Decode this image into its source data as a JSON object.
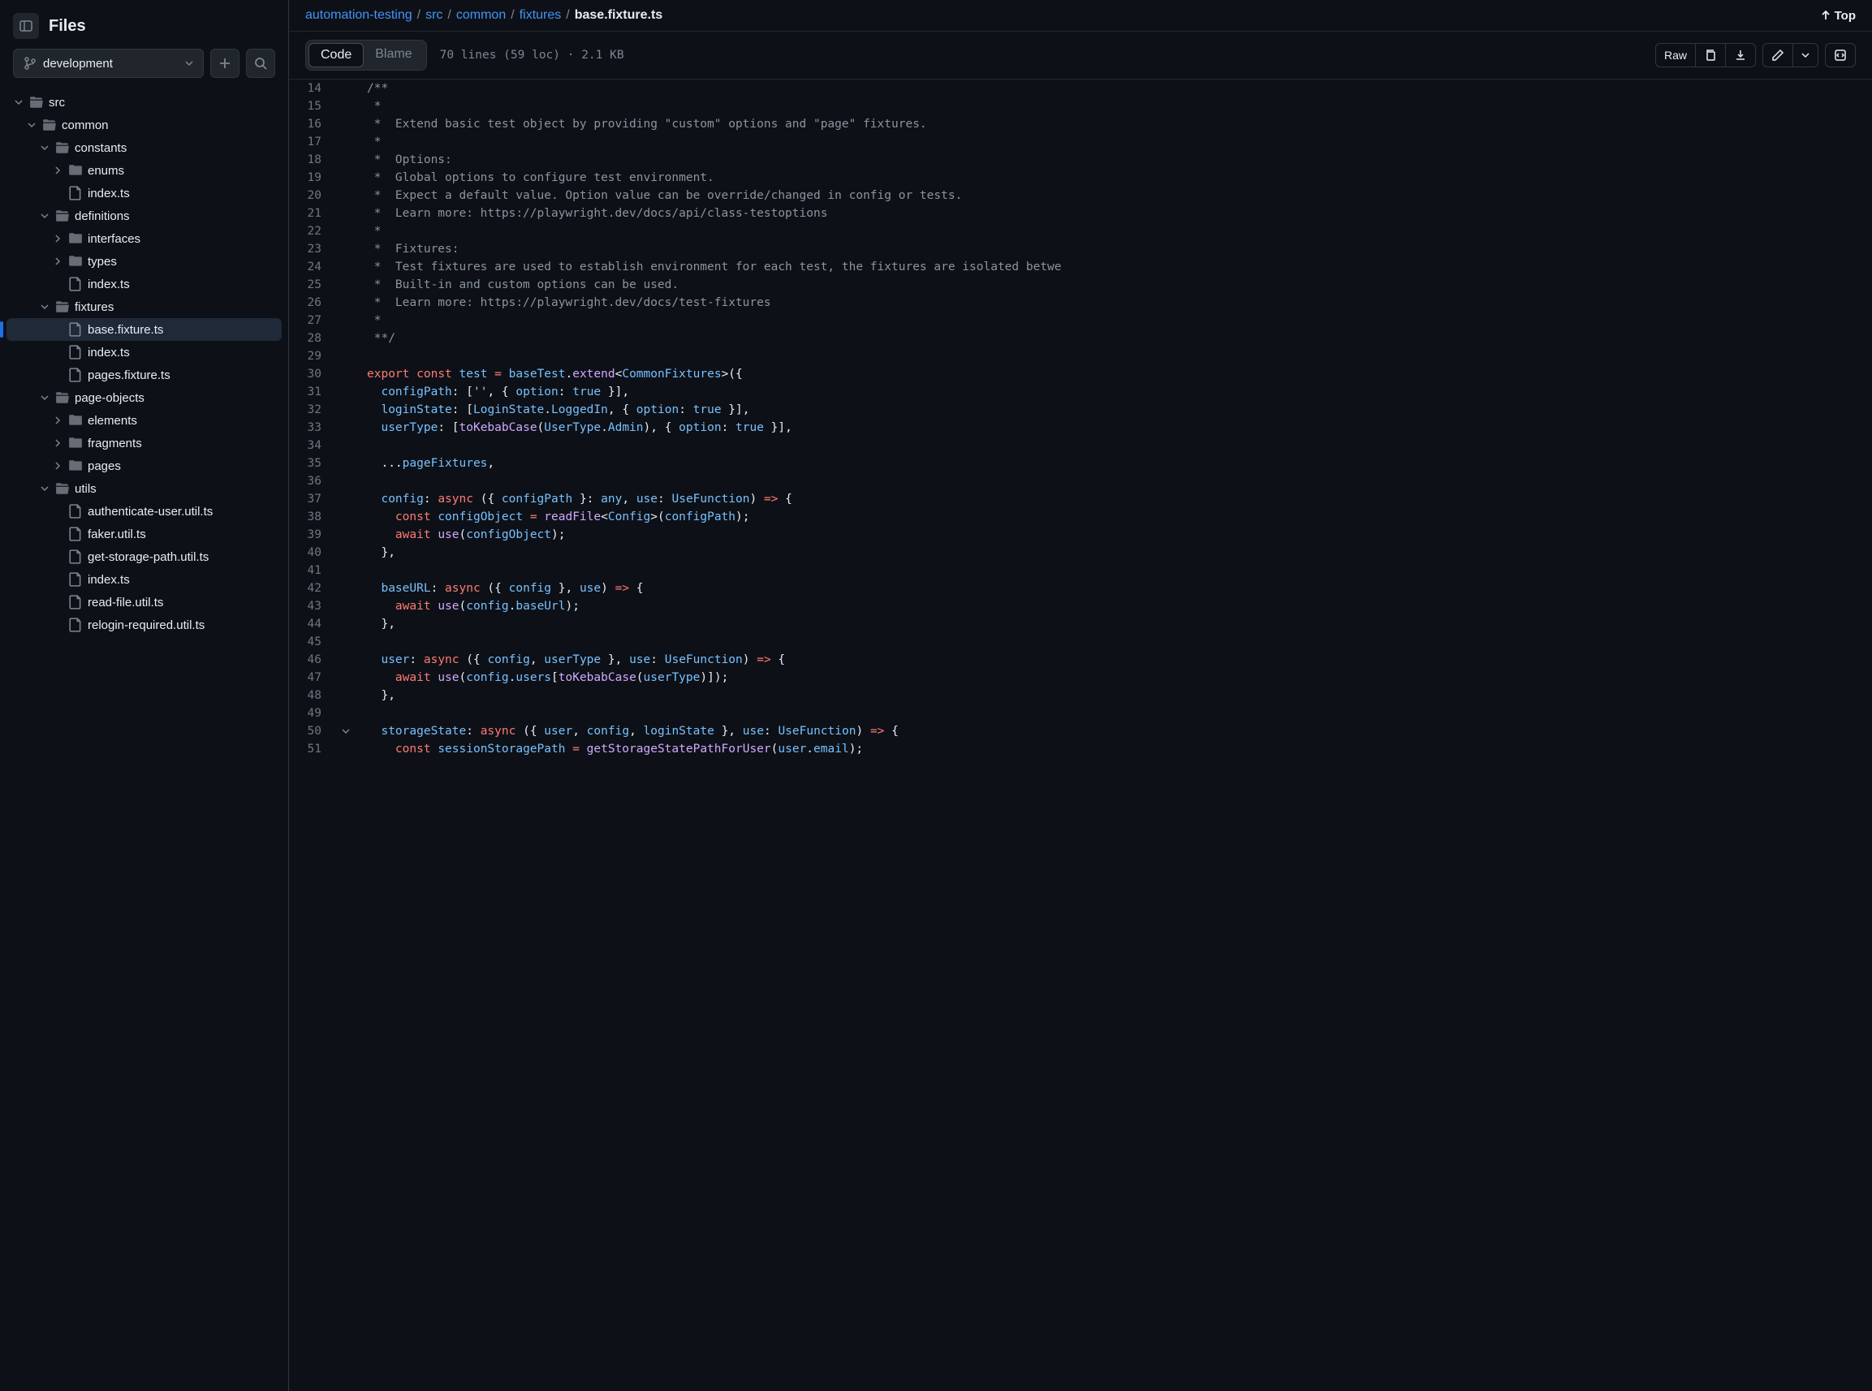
{
  "sidebar": {
    "title": "Files",
    "branch": "development"
  },
  "tree": [
    {
      "depth": 0,
      "type": "folder",
      "expanded": true,
      "label": "src"
    },
    {
      "depth": 1,
      "type": "folder",
      "expanded": true,
      "label": "common"
    },
    {
      "depth": 2,
      "type": "folder",
      "expanded": true,
      "label": "constants"
    },
    {
      "depth": 3,
      "type": "folder",
      "expanded": false,
      "label": "enums"
    },
    {
      "depth": 3,
      "type": "file",
      "label": "index.ts"
    },
    {
      "depth": 2,
      "type": "folder",
      "expanded": true,
      "label": "definitions"
    },
    {
      "depth": 3,
      "type": "folder",
      "expanded": false,
      "label": "interfaces"
    },
    {
      "depth": 3,
      "type": "folder",
      "expanded": false,
      "label": "types"
    },
    {
      "depth": 3,
      "type": "file",
      "label": "index.ts"
    },
    {
      "depth": 2,
      "type": "folder",
      "expanded": true,
      "label": "fixtures"
    },
    {
      "depth": 3,
      "type": "file",
      "label": "base.fixture.ts",
      "active": true
    },
    {
      "depth": 3,
      "type": "file",
      "label": "index.ts"
    },
    {
      "depth": 3,
      "type": "file",
      "label": "pages.fixture.ts"
    },
    {
      "depth": 2,
      "type": "folder",
      "expanded": true,
      "label": "page-objects"
    },
    {
      "depth": 3,
      "type": "folder",
      "expanded": false,
      "label": "elements"
    },
    {
      "depth": 3,
      "type": "folder",
      "expanded": false,
      "label": "fragments"
    },
    {
      "depth": 3,
      "type": "folder",
      "expanded": false,
      "label": "pages"
    },
    {
      "depth": 2,
      "type": "folder",
      "expanded": true,
      "label": "utils"
    },
    {
      "depth": 3,
      "type": "file",
      "label": "authenticate-user.util.ts"
    },
    {
      "depth": 3,
      "type": "file",
      "label": "faker.util.ts"
    },
    {
      "depth": 3,
      "type": "file",
      "label": "get-storage-path.util.ts"
    },
    {
      "depth": 3,
      "type": "file",
      "label": "index.ts"
    },
    {
      "depth": 3,
      "type": "file",
      "label": "read-file.util.ts"
    },
    {
      "depth": 3,
      "type": "file",
      "label": "relogin-required.util.ts"
    }
  ],
  "breadcrumb": {
    "parts": [
      "automation-testing",
      "src",
      "common",
      "fixtures"
    ],
    "current": "base.fixture.ts"
  },
  "topLabel": "Top",
  "tabs": {
    "code": "Code",
    "blame": "Blame"
  },
  "meta": "70 lines (59 loc) · 2.1 KB",
  "rawLabel": "Raw",
  "code": [
    {
      "n": 14,
      "html": "<span class='c-comment'>/**</span>"
    },
    {
      "n": 15,
      "html": "<span class='c-comment'> *</span>"
    },
    {
      "n": 16,
      "html": "<span class='c-comment'> *  Extend basic test object by providing \"custom\" options and \"page\" fixtures.</span>"
    },
    {
      "n": 17,
      "html": "<span class='c-comment'> *</span>"
    },
    {
      "n": 18,
      "html": "<span class='c-comment'> *  Options:</span>"
    },
    {
      "n": 19,
      "html": "<span class='c-comment'> *  Global options to configure test environment.</span>"
    },
    {
      "n": 20,
      "html": "<span class='c-comment'> *  Expect a default value. Option value can be override/changed in config or tests.</span>"
    },
    {
      "n": 21,
      "html": "<span class='c-comment'> *  Learn more: https://playwright.dev/docs/api/class-testoptions</span>"
    },
    {
      "n": 22,
      "html": "<span class='c-comment'> *</span>"
    },
    {
      "n": 23,
      "html": "<span class='c-comment'> *  Fixtures:</span>"
    },
    {
      "n": 24,
      "html": "<span class='c-comment'> *  Test fixtures are used to establish environment for each test, the fixtures are isolated betwe</span>"
    },
    {
      "n": 25,
      "html": "<span class='c-comment'> *  Built-in and custom options can be used.</span>"
    },
    {
      "n": 26,
      "html": "<span class='c-comment'> *  Learn more: https://playwright.dev/docs/test-fixtures</span>"
    },
    {
      "n": 27,
      "html": "<span class='c-comment'> *</span>"
    },
    {
      "n": 28,
      "html": "<span class='c-comment'> **/</span>"
    },
    {
      "n": 29,
      "html": ""
    },
    {
      "n": 30,
      "html": "<span class='c-keyword'>export</span> <span class='c-keyword'>const</span> <span class='c-ident'>test</span> <span class='c-keyword'>=</span> <span class='c-ident'>baseTest</span>.<span class='c-func'>extend</span>&lt;<span class='c-ident'>CommonFixtures</span>&gt;({"
    },
    {
      "n": 31,
      "html": "  <span class='c-ident'>configPath</span>: [<span class='c-string'>''</span>, { <span class='c-ident'>option</span>: <span class='c-ident'>true</span> }],"
    },
    {
      "n": 32,
      "html": "  <span class='c-ident'>loginState</span>: [<span class='c-ident'>LoginState</span>.<span class='c-ident'>LoggedIn</span>, { <span class='c-ident'>option</span>: <span class='c-ident'>true</span> }],"
    },
    {
      "n": 33,
      "html": "  <span class='c-ident'>userType</span>: [<span class='c-func'>toKebabCase</span>(<span class='c-ident'>UserType</span>.<span class='c-ident'>Admin</span>), { <span class='c-ident'>option</span>: <span class='c-ident'>true</span> }],"
    },
    {
      "n": 34,
      "html": ""
    },
    {
      "n": 35,
      "html": "  ...<span class='c-ident'>pageFixtures</span>,"
    },
    {
      "n": 36,
      "html": ""
    },
    {
      "n": 37,
      "html": "  <span class='c-ident'>config</span>: <span class='c-keyword'>async</span> ({ <span class='c-ident'>configPath</span> }: <span class='c-ident'>any</span>, <span class='c-ident'>use</span>: <span class='c-ident'>UseFunction</span>) <span class='c-keyword'>=&gt;</span> {"
    },
    {
      "n": 38,
      "html": "    <span class='c-keyword'>const</span> <span class='c-ident'>configObject</span> <span class='c-keyword'>=</span> <span class='c-func'>readFile</span>&lt;<span class='c-ident'>Config</span>&gt;(<span class='c-ident'>configPath</span>);"
    },
    {
      "n": 39,
      "html": "    <span class='c-keyword'>await</span> <span class='c-func'>use</span>(<span class='c-ident'>configObject</span>);"
    },
    {
      "n": 40,
      "html": "  },"
    },
    {
      "n": 41,
      "html": ""
    },
    {
      "n": 42,
      "html": "  <span class='c-ident'>baseURL</span>: <span class='c-keyword'>async</span> ({ <span class='c-ident'>config</span> }, <span class='c-ident'>use</span>) <span class='c-keyword'>=&gt;</span> {"
    },
    {
      "n": 43,
      "html": "    <span class='c-keyword'>await</span> <span class='c-func'>use</span>(<span class='c-ident'>config</span>.<span class='c-ident'>baseUrl</span>);"
    },
    {
      "n": 44,
      "html": "  },"
    },
    {
      "n": 45,
      "html": ""
    },
    {
      "n": 46,
      "html": "  <span class='c-ident'>user</span>: <span class='c-keyword'>async</span> ({ <span class='c-ident'>config</span>, <span class='c-ident'>userType</span> }, <span class='c-ident'>use</span>: <span class='c-ident'>UseFunction</span>) <span class='c-keyword'>=&gt;</span> {"
    },
    {
      "n": 47,
      "html": "    <span class='c-keyword'>await</span> <span class='c-func'>use</span>(<span class='c-ident'>config</span>.<span class='c-ident'>users</span>[<span class='c-func'>toKebabCase</span>(<span class='c-ident'>userType</span>)]);"
    },
    {
      "n": 48,
      "html": "  },"
    },
    {
      "n": 49,
      "html": ""
    },
    {
      "n": 50,
      "gutter": "v",
      "html": "  <span class='c-ident'>storageState</span>: <span class='c-keyword'>async</span> ({ <span class='c-ident'>user</span>, <span class='c-ident'>config</span>, <span class='c-ident'>loginState</span> }, <span class='c-ident'>use</span>: <span class='c-ident'>UseFunction</span>) <span class='c-keyword'>=&gt;</span> {"
    },
    {
      "n": 51,
      "html": "    <span class='c-keyword'>const</span> <span class='c-ident'>sessionStoragePath</span> <span class='c-keyword'>=</span> <span class='c-func'>getStorageStatePathForUser</span>(<span class='c-ident'>user</span>.<span class='c-ident'>email</span>);"
    }
  ]
}
